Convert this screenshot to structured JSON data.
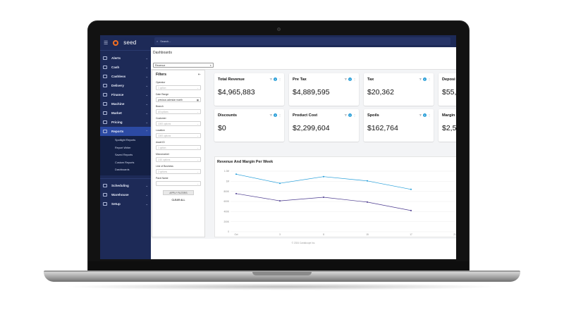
{
  "app": {
    "brand": "seed"
  },
  "search": {
    "placeholder": "Search..."
  },
  "sidebar": {
    "items": [
      {
        "label": "Alerts",
        "icon": "alert-icon"
      },
      {
        "label": "Cash",
        "icon": "cash-icon"
      },
      {
        "label": "Cashless",
        "icon": "card-icon"
      },
      {
        "label": "Delivery",
        "icon": "truck-icon"
      },
      {
        "label": "Finance",
        "icon": "bank-icon"
      },
      {
        "label": "Machine",
        "icon": "machine-icon"
      },
      {
        "label": "Market",
        "icon": "store-icon"
      },
      {
        "label": "Pricing",
        "icon": "tag-icon"
      },
      {
        "label": "Reports",
        "icon": "report-icon",
        "active": true
      }
    ],
    "report_subitems": [
      "Spotlight Reports",
      "Report Writer",
      "Saved Reports",
      "Custom Reports",
      "Dashboards"
    ],
    "lower_items": [
      {
        "label": "Scheduling",
        "icon": "calendar-icon"
      },
      {
        "label": "Warehouse",
        "icon": "warehouse-icon"
      },
      {
        "label": "Setup",
        "icon": "gear-icon"
      }
    ]
  },
  "page": {
    "title": "Dashboards",
    "dashboard_select": "Revenue"
  },
  "filters": {
    "title": "Filters",
    "fields": [
      {
        "label": "Operator",
        "value": "1 option",
        "is_value": false
      },
      {
        "label": "Date Range",
        "value": "previous calendar month",
        "is_value": true
      },
      {
        "label": "Branch",
        "value": "All options",
        "is_value": false
      },
      {
        "label": "Customer",
        "value": "1000 options",
        "is_value": false
      },
      {
        "label": "Location",
        "value": "1000 options",
        "is_value": false
      },
      {
        "label": "Asset ID",
        "value": "1 option",
        "is_value": false
      },
      {
        "label": "Micromarket",
        "value": "1/10 options",
        "is_value": false
      },
      {
        "label": "Line of Business",
        "value": "2 options",
        "is_value": false
      },
      {
        "label": "Pack Name",
        "value": "",
        "is_value": false
      }
    ],
    "apply_label": "APPLY FILTERS",
    "clear_label": "CLEAR ALL"
  },
  "cards": [
    {
      "title": "Total Revenue",
      "value": "$4,965,883"
    },
    {
      "title": "Pre Tax",
      "value": "$4,889,595"
    },
    {
      "title": "Tax",
      "value": "$20,362"
    },
    {
      "title": "Deposi",
      "value": "$55,"
    },
    {
      "title": "Discounts",
      "value": "$0"
    },
    {
      "title": "Product Cost",
      "value": "$2,299,604"
    },
    {
      "title": "Spoils",
      "value": "$162,764"
    },
    {
      "title": "Margin",
      "value": "$2,5"
    }
  ],
  "chart_data": {
    "type": "line",
    "title": "Revenue And Margin Per Week",
    "y_ticks": [
      "1.0M",
      "1M",
      "800K",
      "600K",
      "400K",
      "200K",
      "0"
    ],
    "x_ticks": [
      "Oct",
      "3",
      "8",
      "15",
      "17",
      "21"
    ],
    "ylim": [
      0,
      1000000
    ],
    "x": [
      0,
      1,
      2,
      3,
      4,
      5
    ],
    "series": [
      {
        "values": [
          950000,
          800000,
          910000,
          840000,
          700000
        ],
        "color": "#1f9cd9"
      },
      {
        "values": [
          630000,
          510000,
          570000,
          490000,
          350000
        ],
        "color": "#4b3a8f"
      }
    ]
  },
  "footer": {
    "text": "© 2024 Cantaloupe Inc."
  }
}
